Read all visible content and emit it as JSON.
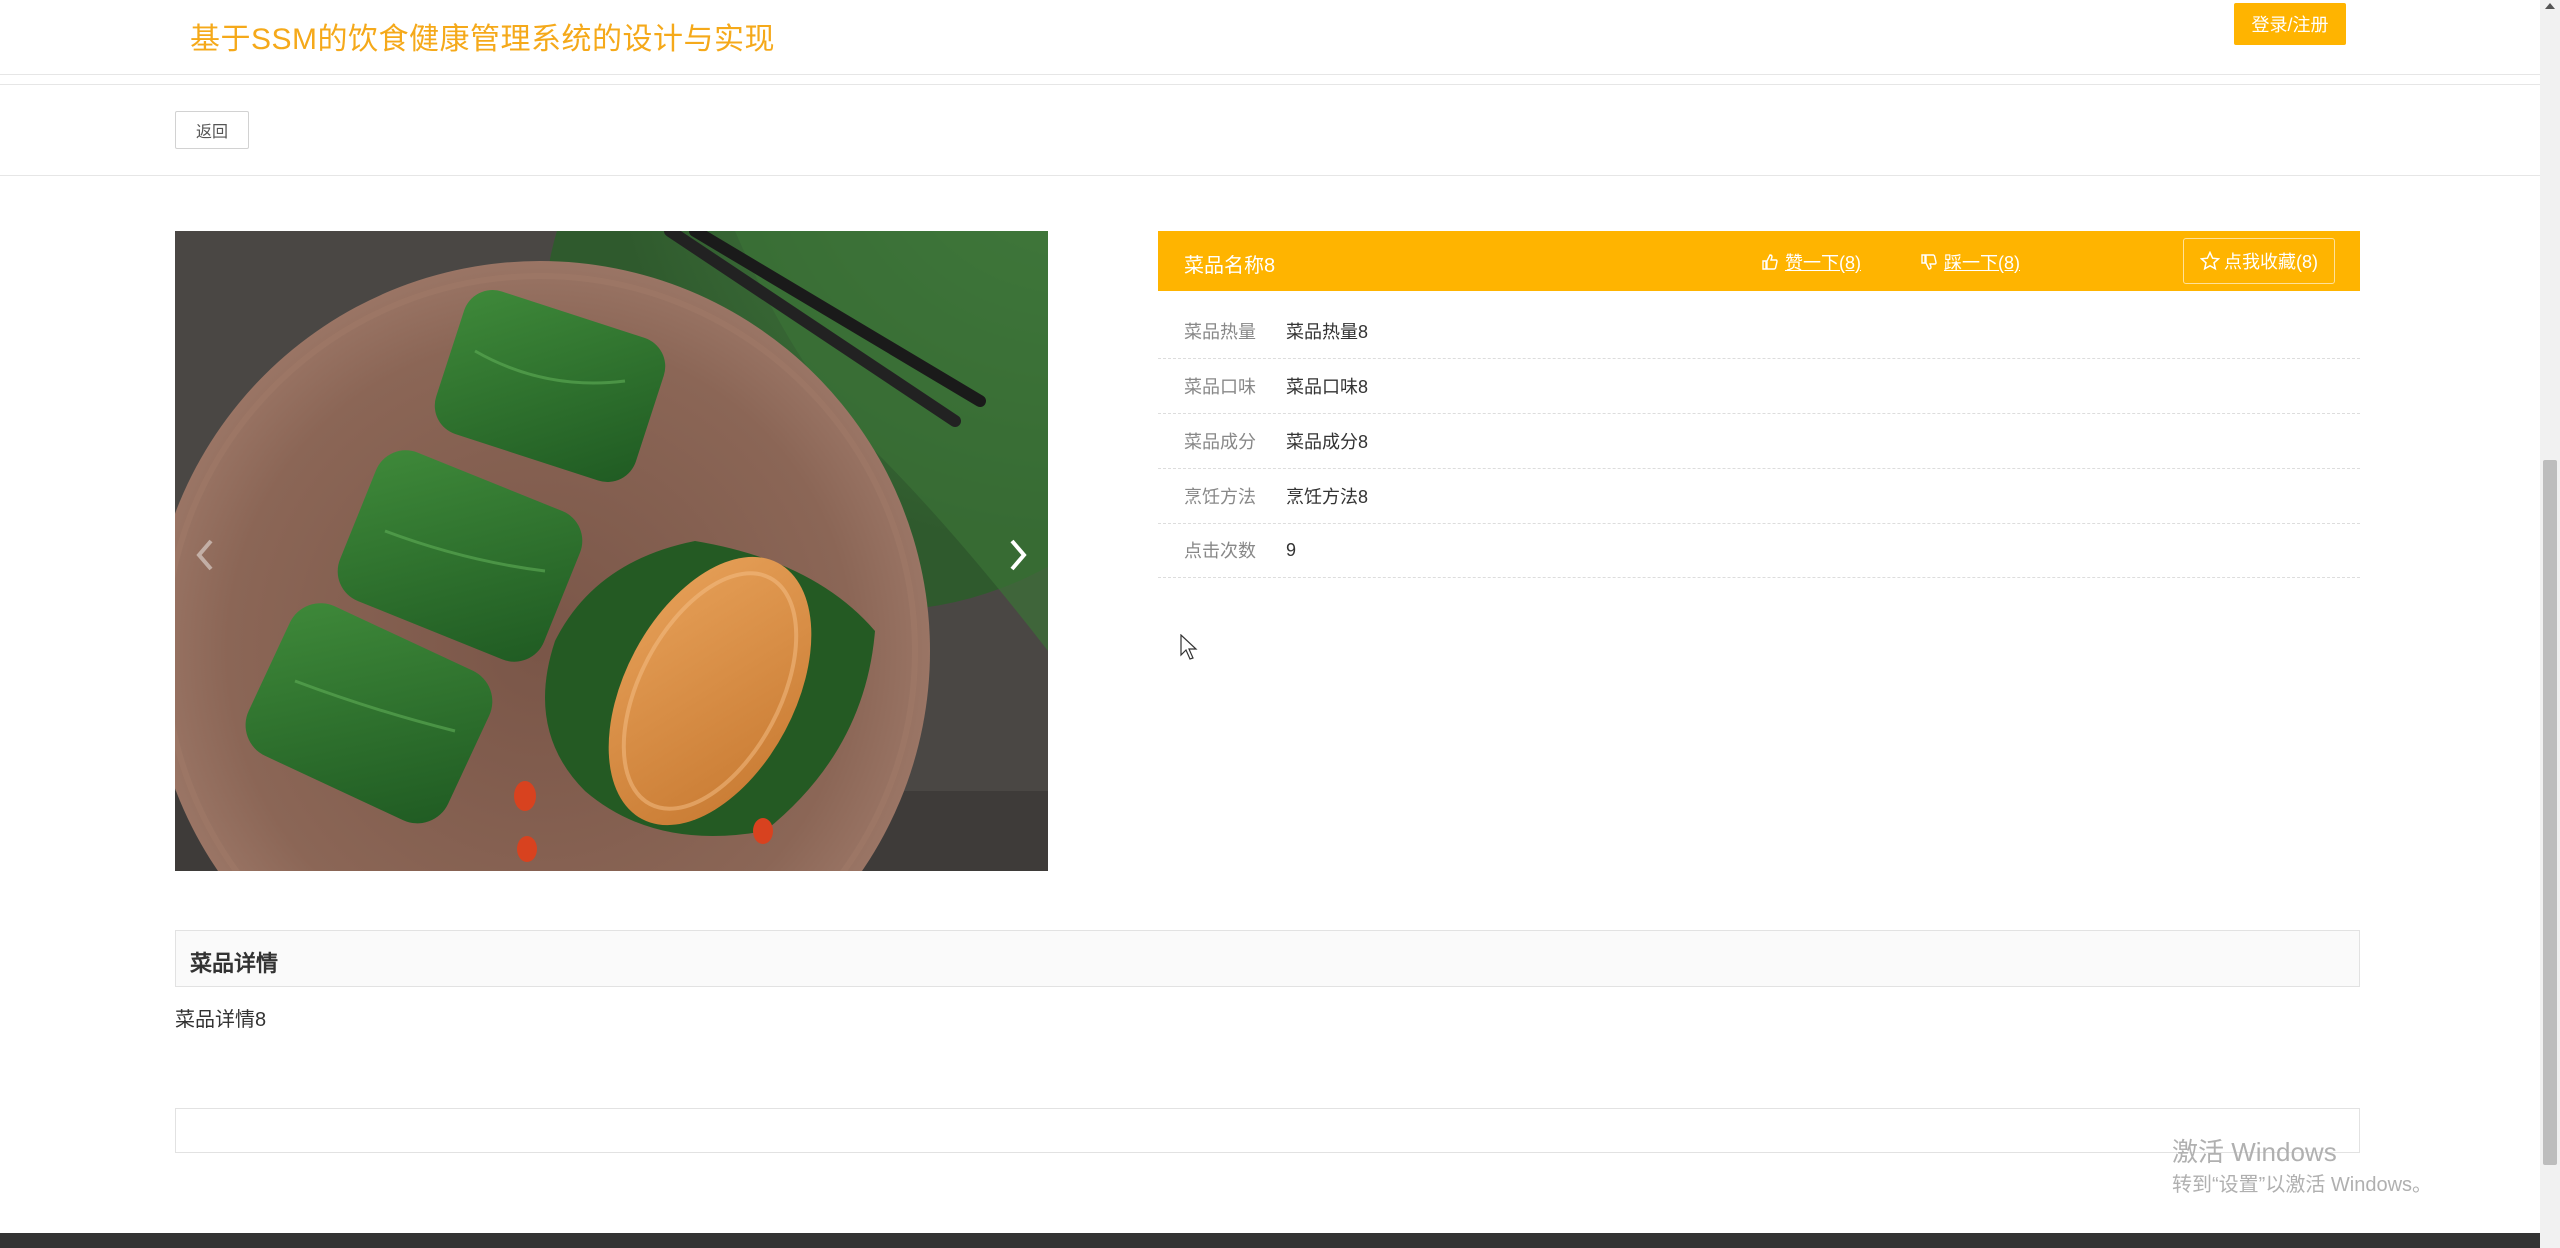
{
  "header": {
    "title": "基于SSM的饮食健康管理系统的设计与实现",
    "login_label": "登录/注册"
  },
  "toolbar": {
    "back_label": "返回"
  },
  "dish": {
    "name": "菜品名称8",
    "like_label": "赞一下(8)",
    "dislike_label": "踩一下(8)",
    "collect_label": "点我收藏(8)",
    "fields": [
      {
        "label": "菜品热量",
        "value": "菜品热量8"
      },
      {
        "label": "菜品口味",
        "value": "菜品口味8"
      },
      {
        "label": "菜品成分",
        "value": "菜品成分8"
      },
      {
        "label": "烹饪方法",
        "value": "烹饪方法8"
      },
      {
        "label": "点击次数",
        "value": "9"
      }
    ]
  },
  "details": {
    "title": "菜品详情",
    "content": "菜品详情8"
  },
  "watermark": {
    "line1": "激活 Windows",
    "line2": "转到“设置”以激活 Windows。"
  },
  "colors": {
    "accent": "#ffb400",
    "title": "#f5a91a"
  },
  "icons": {
    "like": "thumbs-up-icon",
    "dislike": "thumbs-down-icon",
    "collect": "star-icon",
    "prev": "chevron-left-icon",
    "next": "chevron-right-icon"
  }
}
